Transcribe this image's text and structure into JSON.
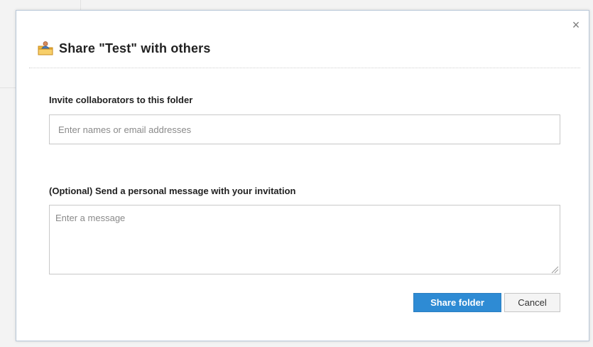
{
  "dialog": {
    "title": "Share \"Test\" with others",
    "title_icon": "shared-folder-icon",
    "close_icon": "close-icon",
    "close_glyph": "×"
  },
  "invite": {
    "label": "Invite collaborators to this folder",
    "placeholder": "Enter names or email addresses",
    "value": ""
  },
  "message": {
    "label": "(Optional) Send a personal message with your invitation",
    "placeholder": "Enter a message",
    "value": ""
  },
  "actions": {
    "share_label": "Share folder",
    "cancel_label": "Cancel"
  },
  "colors": {
    "primary_button": "#2e8bd4",
    "dialog_border": "#b8c7d8"
  }
}
